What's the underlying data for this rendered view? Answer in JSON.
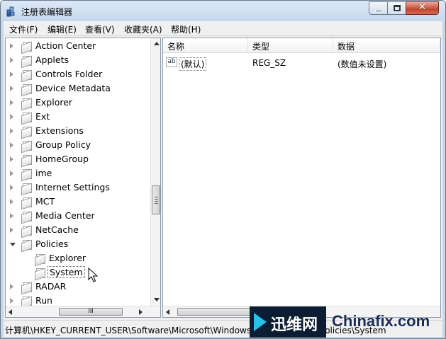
{
  "window": {
    "title": "注册表编辑器",
    "close_glyph": "✕"
  },
  "menu": [
    "文件(F)",
    "编辑(E)",
    "查看(V)",
    "收藏夹(A)",
    "帮助(H)"
  ],
  "tree": {
    "items": [
      {
        "label": "Action Center",
        "expanded": false,
        "depth": 0
      },
      {
        "label": "Applets",
        "expanded": false,
        "depth": 0
      },
      {
        "label": "Controls Folder",
        "expanded": false,
        "depth": 0
      },
      {
        "label": "Device Metadata",
        "expanded": false,
        "depth": 0
      },
      {
        "label": "Explorer",
        "expanded": false,
        "depth": 0
      },
      {
        "label": "Ext",
        "expanded": false,
        "depth": 0
      },
      {
        "label": "Extensions",
        "expanded": false,
        "depth": 0
      },
      {
        "label": "Group Policy",
        "expanded": false,
        "depth": 0
      },
      {
        "label": "HomeGroup",
        "expanded": false,
        "depth": 0
      },
      {
        "label": "ime",
        "expanded": false,
        "depth": 0
      },
      {
        "label": "Internet Settings",
        "expanded": false,
        "depth": 0
      },
      {
        "label": "MCT",
        "expanded": false,
        "depth": 0
      },
      {
        "label": "Media Center",
        "expanded": false,
        "depth": 0
      },
      {
        "label": "NetCache",
        "expanded": false,
        "depth": 0
      },
      {
        "label": "Policies",
        "expanded": true,
        "depth": 0
      },
      {
        "label": "Explorer",
        "expanded": false,
        "depth": 1
      },
      {
        "label": "System",
        "expanded": false,
        "depth": 1,
        "selected": true
      },
      {
        "label": "RADAR",
        "expanded": false,
        "depth": 0
      },
      {
        "label": "Run",
        "expanded": false,
        "depth": 0
      }
    ],
    "scroll_thumb_glyph": "≡",
    "hscroll_thumb_glyph": "III"
  },
  "list": {
    "columns": [
      "名称",
      "类型",
      "数据"
    ],
    "rows": [
      {
        "icon": "ab",
        "name": "(默认)",
        "type": "REG_SZ",
        "data": "(数值未设置)"
      }
    ]
  },
  "status": {
    "path": "计算机\\HKEY_CURRENT_USER\\Software\\Microsoft\\Windows\\CurrentVersion\\Policies\\System"
  },
  "watermark": {
    "cn": "迅维网",
    "en": "Chinafix.com"
  }
}
